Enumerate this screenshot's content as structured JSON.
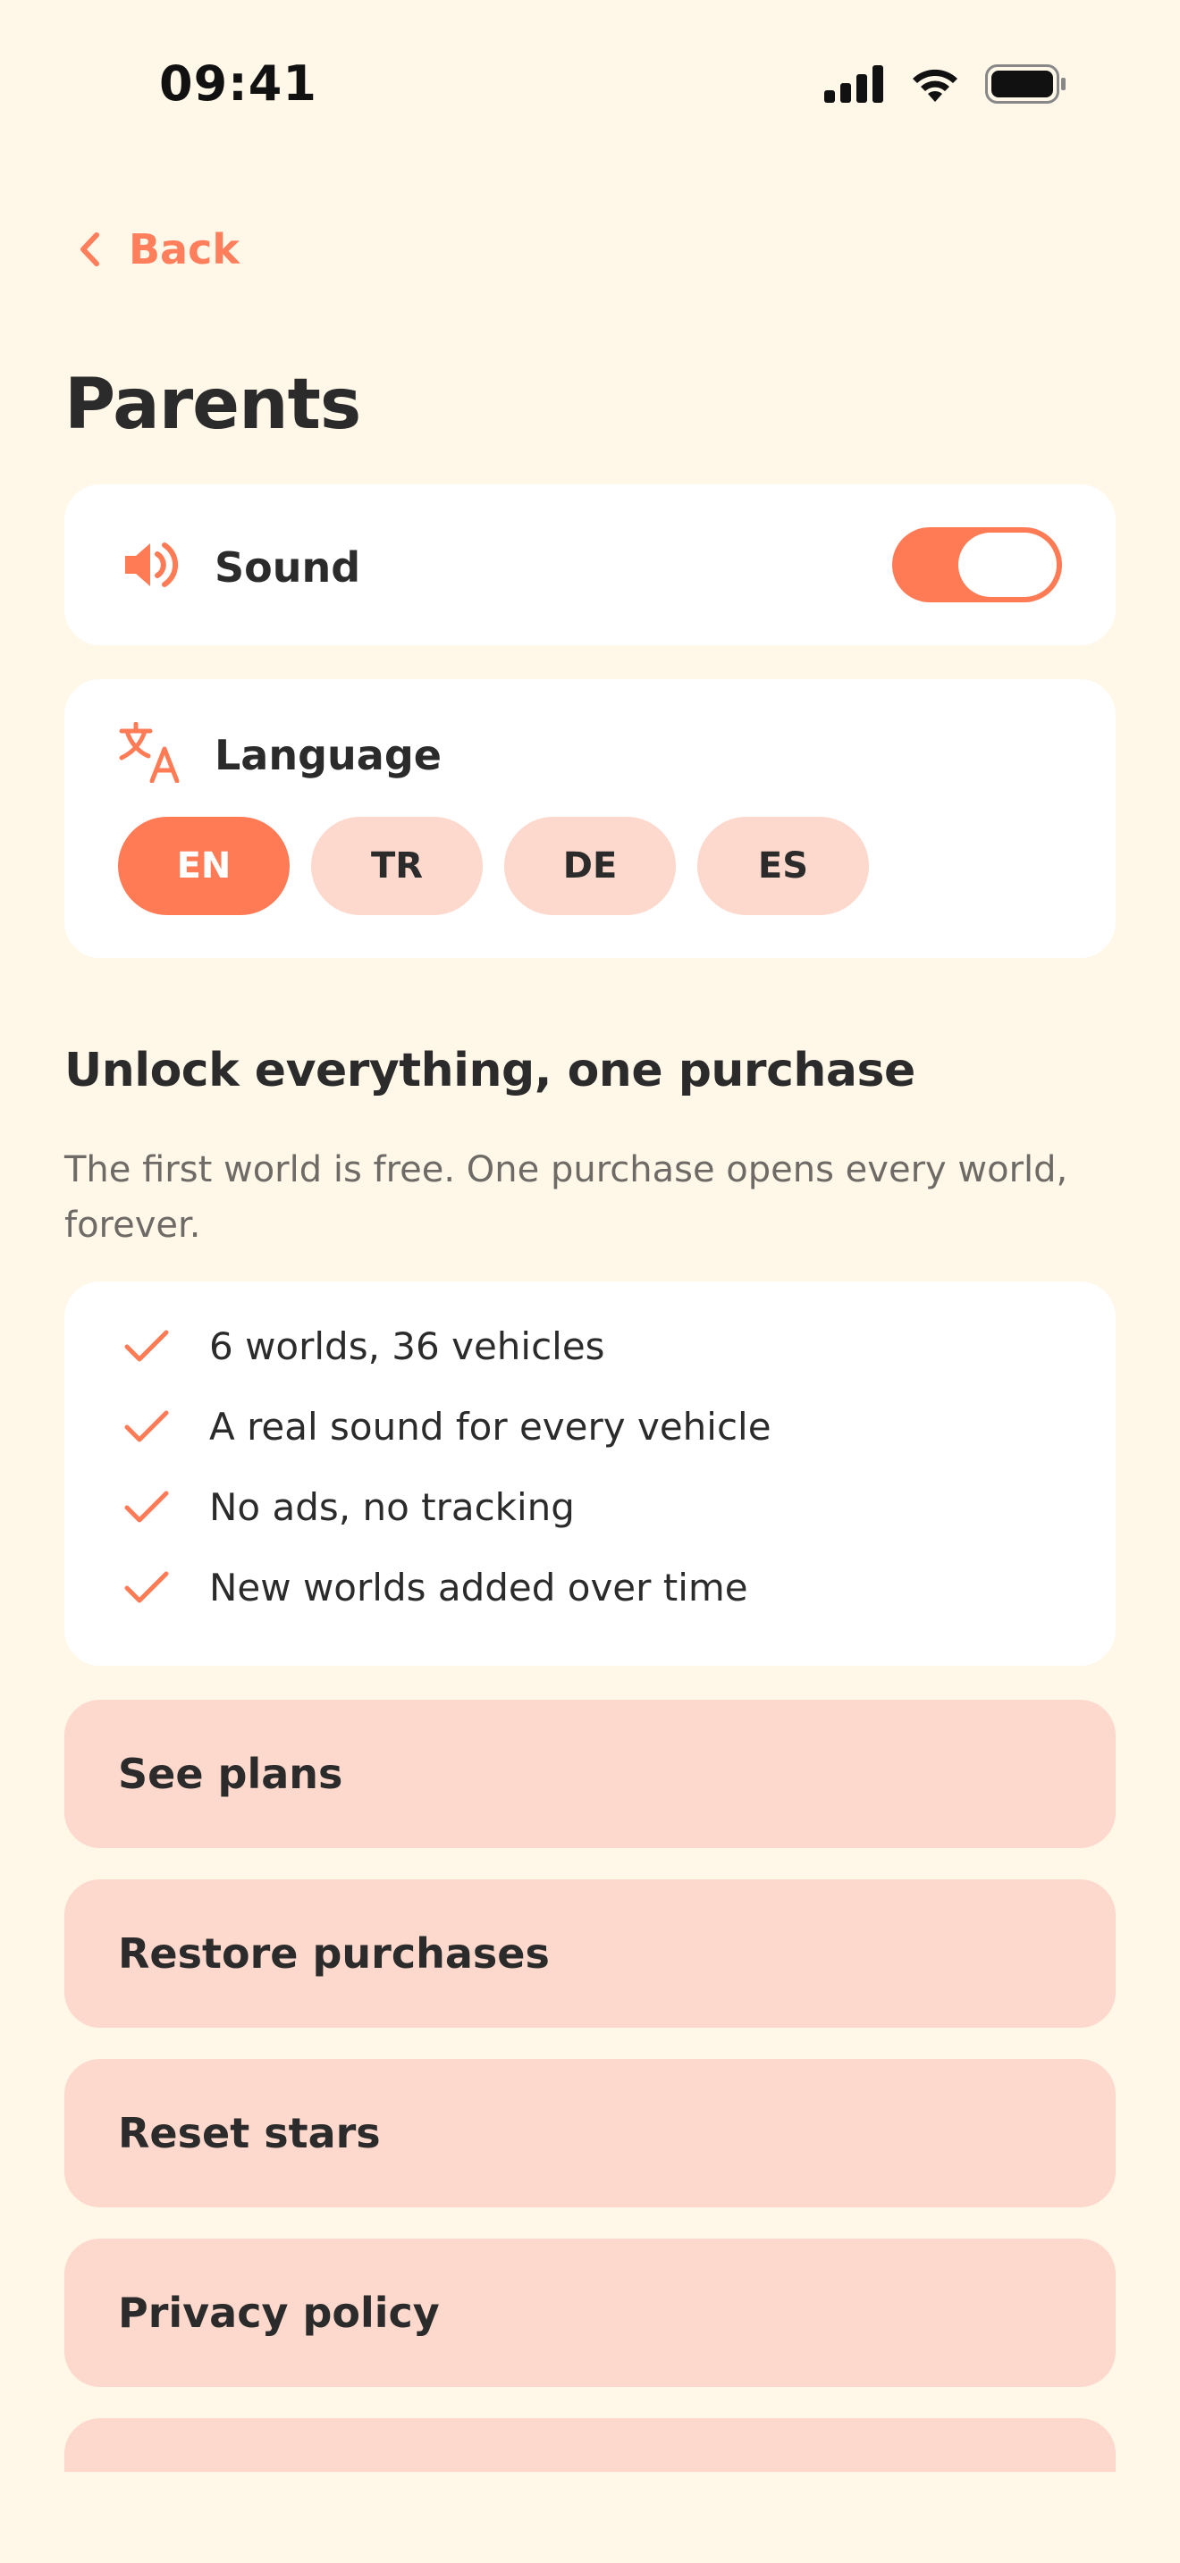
{
  "status_bar": {
    "time": "09:41",
    "icons": [
      "cellular-signal-icon",
      "wifi-icon",
      "battery-icon"
    ]
  },
  "nav": {
    "back_label": "Back",
    "back_icon": "chevron-left-icon"
  },
  "page_title": "Parents",
  "settings": {
    "sound": {
      "label": "Sound",
      "icon": "speaker-icon",
      "enabled": true
    },
    "language": {
      "label": "Language",
      "icon": "translate-icon",
      "options": [
        "EN",
        "TR",
        "DE",
        "ES"
      ],
      "selected": "EN"
    }
  },
  "purchase": {
    "title": "Unlock everything, one purchase",
    "subtitle": "The first world is free. One purchase opens every world, forever.",
    "features": [
      "6 worlds, 36 vehicles",
      "A real sound for every vehicle",
      "No ads, no tracking",
      "New worlds added over time"
    ]
  },
  "actions": [
    {
      "label": "See plans"
    },
    {
      "label": "Restore purchases"
    },
    {
      "label": "Reset stars"
    },
    {
      "label": "Privacy policy"
    }
  ],
  "colors": {
    "background": "#FFF7E8",
    "accent": "#FF7B56",
    "chip_inactive": "#FDD8CC",
    "card": "#FFFFFF",
    "text": "#2B2B2B",
    "muted_text": "#6E6A66"
  }
}
